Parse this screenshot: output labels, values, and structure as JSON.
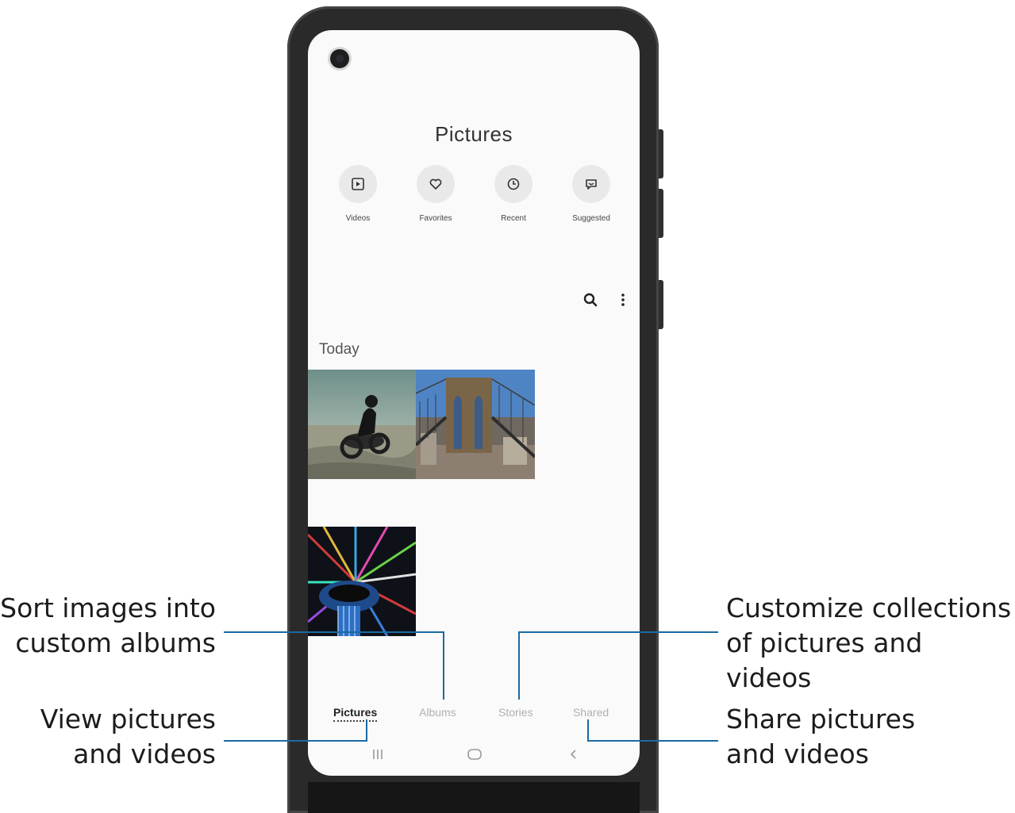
{
  "app": {
    "title": "Pictures",
    "accent_line_color": "#1a6aa3"
  },
  "shortcuts": [
    {
      "label": "Videos",
      "icon": "video-icon"
    },
    {
      "label": "Favorites",
      "icon": "heart-icon"
    },
    {
      "label": "Recent",
      "icon": "clock-icon"
    },
    {
      "label": "Suggested",
      "icon": "suggested-icon"
    }
  ],
  "toolbar": {
    "search_icon": "search-icon",
    "more_icon": "more-vertical-icon"
  },
  "gallery": {
    "section_label": "Today",
    "thumbnails": [
      "motorcycle-photo",
      "bridge-photo",
      "ferris-wheel-photo"
    ]
  },
  "tabs": [
    {
      "label": "Pictures",
      "active": true
    },
    {
      "label": "Albums",
      "active": false
    },
    {
      "label": "Stories",
      "active": false
    },
    {
      "label": "Shared",
      "active": false
    }
  ],
  "navigation": [
    "recents-icon",
    "home-icon",
    "back-icon"
  ],
  "callouts": {
    "albums": "Sort images into\ncustom albums",
    "pictures": "View pictures\nand videos",
    "stories": "Customize collections\nof pictures and videos",
    "shared": "Share pictures\nand videos"
  }
}
